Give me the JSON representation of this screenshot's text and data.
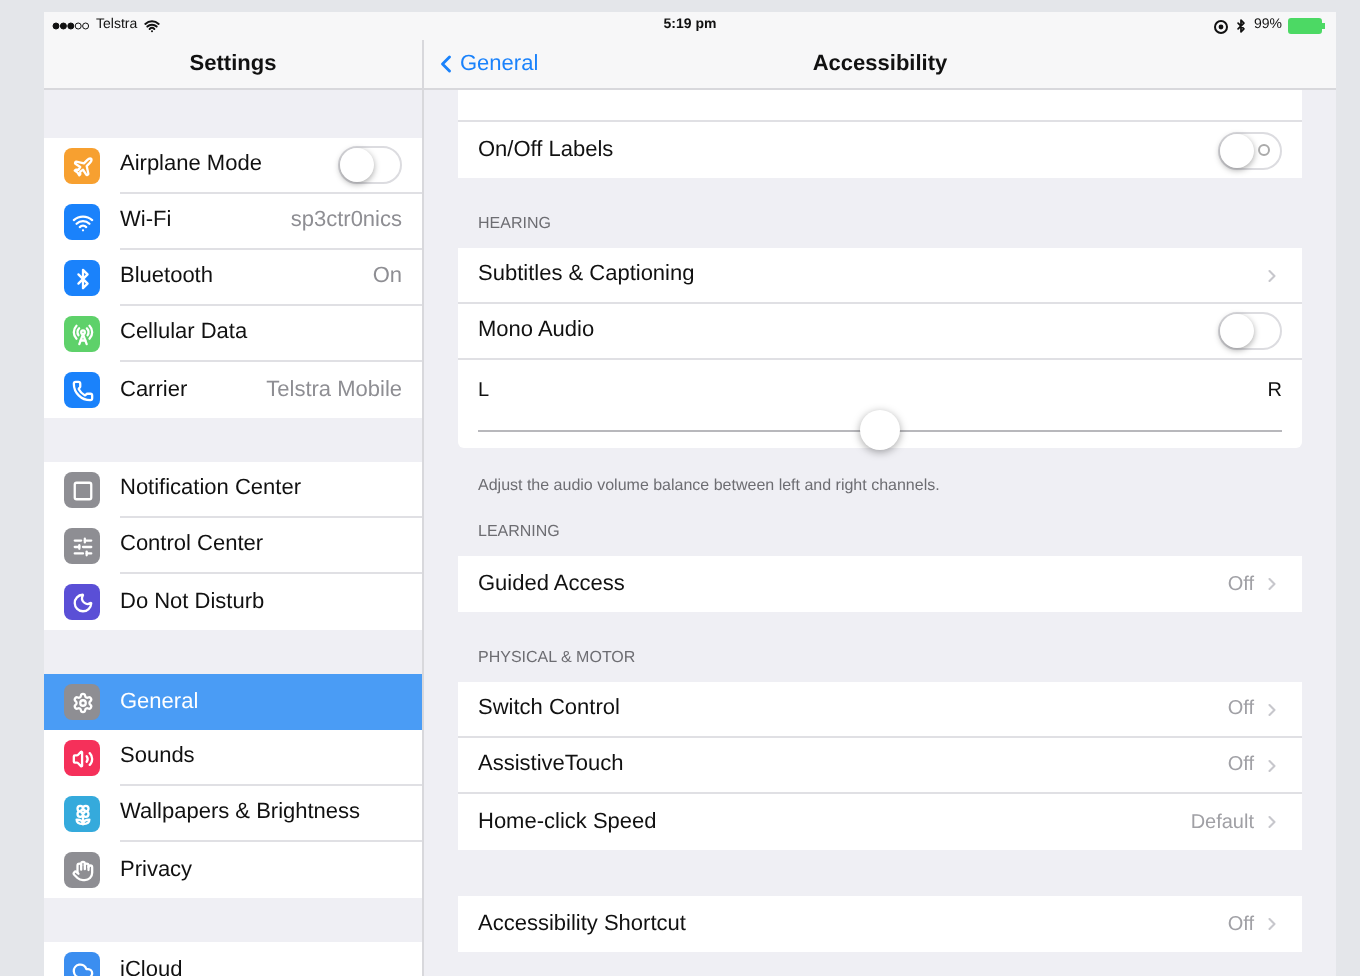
{
  "status_bar": {
    "carrier": "Telstra",
    "time": "5:19 pm",
    "battery": "99%"
  },
  "sidebar": {
    "title": "Settings",
    "groups": [
      {
        "items": [
          {
            "label": "Airplane Mode",
            "kind": "toggle",
            "on": false,
            "color": "#f7a030",
            "selected": false
          },
          {
            "label": "Wi-Fi",
            "kind": "value",
            "value": "sp3ctr0nics",
            "color": "#1a82fb",
            "selected": false
          },
          {
            "label": "Bluetooth",
            "kind": "value",
            "value": "On",
            "color": "#1a82fb",
            "selected": false
          },
          {
            "label": "Cellular Data",
            "kind": "plain",
            "color": "#5ed16a",
            "selected": false
          },
          {
            "label": "Carrier",
            "kind": "value",
            "value": "Telstra Mobile",
            "color": "#1a82fb",
            "selected": false
          }
        ]
      },
      {
        "items": [
          {
            "label": "Notification Center",
            "kind": "plain",
            "color": "#8e8e93",
            "selected": false
          },
          {
            "label": "Control Center",
            "kind": "plain",
            "color": "#8e8e93",
            "selected": false
          },
          {
            "label": "Do Not Disturb",
            "kind": "plain",
            "color": "#5a4fd6",
            "selected": false
          }
        ]
      },
      {
        "items": [
          {
            "label": "General",
            "kind": "plain",
            "color": "#8e8e93",
            "selected": true
          },
          {
            "label": "Sounds",
            "kind": "plain",
            "color": "#f5305a",
            "selected": false
          },
          {
            "label": "Wallpapers & Brightness",
            "kind": "plain",
            "color": "#35aadc",
            "selected": false
          },
          {
            "label": "Privacy",
            "kind": "plain",
            "color": "#8e8e93",
            "selected": false
          }
        ]
      },
      {
        "items": [
          {
            "label": "iCloud",
            "kind": "plain",
            "color": "#3b8ef0",
            "selected": false
          }
        ]
      }
    ]
  },
  "nav": {
    "back": "General",
    "title": "Accessibility"
  },
  "sections": [
    {
      "rows": [
        {
          "kind": "toggle",
          "label": "On/Off Labels",
          "on": false,
          "glyph": true
        }
      ]
    },
    {
      "header": "HEARING",
      "rows": [
        {
          "kind": "chevron",
          "label": "Subtitles & Captioning"
        },
        {
          "kind": "toggle",
          "label": "Mono Audio",
          "on": false,
          "glyph": false
        },
        {
          "kind": "balance",
          "left": "L",
          "right": "R",
          "level": 0.5
        }
      ],
      "footer": "Adjust the audio volume balance between left and right channels."
    },
    {
      "header": "LEARNING",
      "rows": [
        {
          "kind": "value",
          "label": "Guided Access",
          "value": "Off"
        }
      ]
    },
    {
      "header": "PHYSICAL & MOTOR",
      "rows": [
        {
          "kind": "value",
          "label": "Switch Control",
          "value": "Off"
        },
        {
          "kind": "value",
          "label": "AssistiveTouch",
          "value": "Off"
        },
        {
          "kind": "value",
          "label": "Home-click Speed",
          "value": "Default"
        }
      ]
    },
    {
      "rows": [
        {
          "kind": "value",
          "label": "Accessibility Shortcut",
          "value": "Off"
        }
      ]
    }
  ]
}
